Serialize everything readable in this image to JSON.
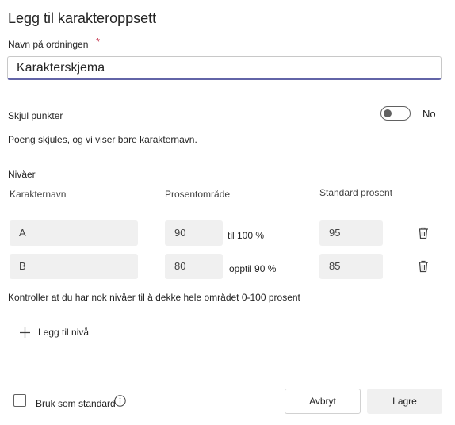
{
  "dialog": {
    "title": "Legg til karakteroppsett",
    "name_label": "Navn på ordningen",
    "required_mark": "*",
    "name_value": "Karakterskjema",
    "hide_points_label": "Skjul punkter",
    "hide_points_state": "No",
    "hide_points_on": false,
    "hide_points_description": "Poeng skjules, og vi viser bare karakternavn.",
    "levels_heading": "Nivåer",
    "columns": {
      "grade_name": "Karakternavn",
      "percent_range": "Prosentområde",
      "default_percent": "Standard prosent"
    },
    "levels": [
      {
        "name": "A",
        "range_value": "90",
        "range_text": "til 100 %",
        "default_value": "95"
      },
      {
        "name": "B",
        "range_value": "80",
        "range_text": "opptil 90 %",
        "default_value": "85"
      }
    ],
    "coverage_warning": "Kontroller at du har nok nivåer til å dekke hele området 0-100 prosent",
    "add_level_label": "Legg til nivå",
    "use_as_default_label": "Bruk som standard",
    "use_as_default_checked": false,
    "cancel_label": "Avbryt",
    "save_label": "Lagre"
  },
  "icons": {
    "trash": "trash-icon",
    "plus": "plus-icon",
    "info": "info-icon"
  },
  "colors": {
    "accent": "#6264a7",
    "required": "#c4314b",
    "field_bg": "#f0f0f0"
  }
}
